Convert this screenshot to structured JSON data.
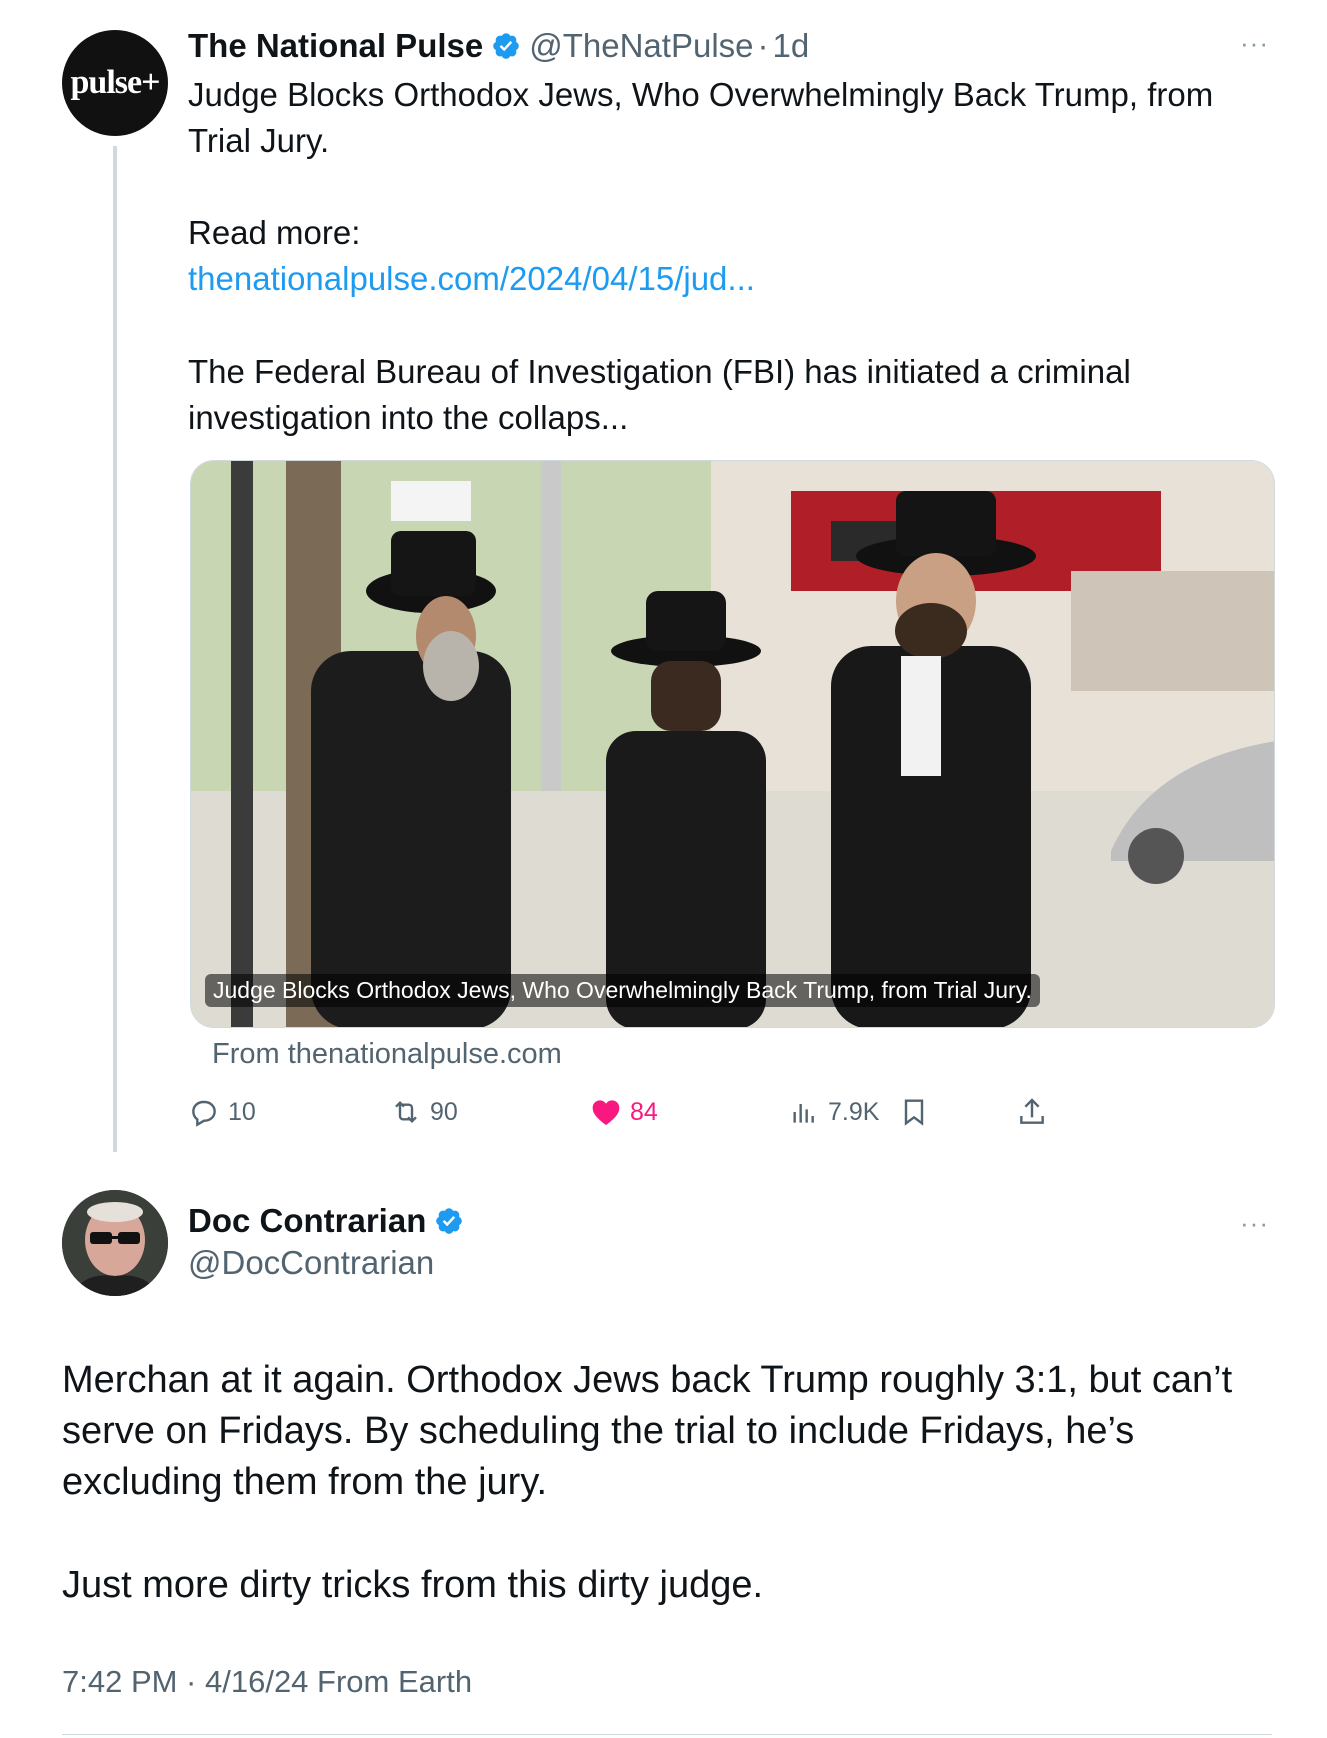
{
  "quoted_tweet": {
    "author_name": "The National Pulse",
    "avatar_logo_text": "pulse+",
    "handle": "@TheNatPulse",
    "separator": "·",
    "age": "1d",
    "more_label": "···",
    "text_line_1": "Judge Blocks Orthodox Jews, Who Overwhelmingly Back Trump, from",
    "text_line_2": "Trial Jury.",
    "read_more_label": "Read more:",
    "link_text": "thenationalpulse.com/2024/04/15/jud...",
    "teaser_line_1": "The Federal Bureau of Investigation (FBI) has initiated a criminal",
    "teaser_line_2": "investigation into the collaps...",
    "card": {
      "image_caption": "Judge Blocks Orthodox Jews, Who Overwhelmingly Back Trump, from Trial Jury.",
      "source_text": "From thenationalpulse.com"
    },
    "metrics": {
      "replies": "10",
      "reposts": "90",
      "likes": "84",
      "views": "7.9K"
    },
    "colors": {
      "like_active": "#f91880",
      "link": "#1d9bf0",
      "verified": "#1d9bf0"
    }
  },
  "main_tweet": {
    "author_name": "Doc Contrarian",
    "handle": "@DocContrarian",
    "more_label": "···",
    "text_lines": [
      "Merchan at it again. Orthodox Jews back Trump roughly 3:1, but can’t",
      "serve on Fridays. By scheduling the trial to include Fridays, he’s",
      "excluding them from the jury."
    ],
    "closing_line": "Just more dirty tricks from this dirty judge.",
    "timestamp": "7:42 PM · 4/16/24 From Earth"
  },
  "icons": [
    "verified-badge-icon",
    "more-icon",
    "reply-icon",
    "repost-icon",
    "like-icon",
    "views-icon",
    "bookmark-icon",
    "share-icon"
  ]
}
